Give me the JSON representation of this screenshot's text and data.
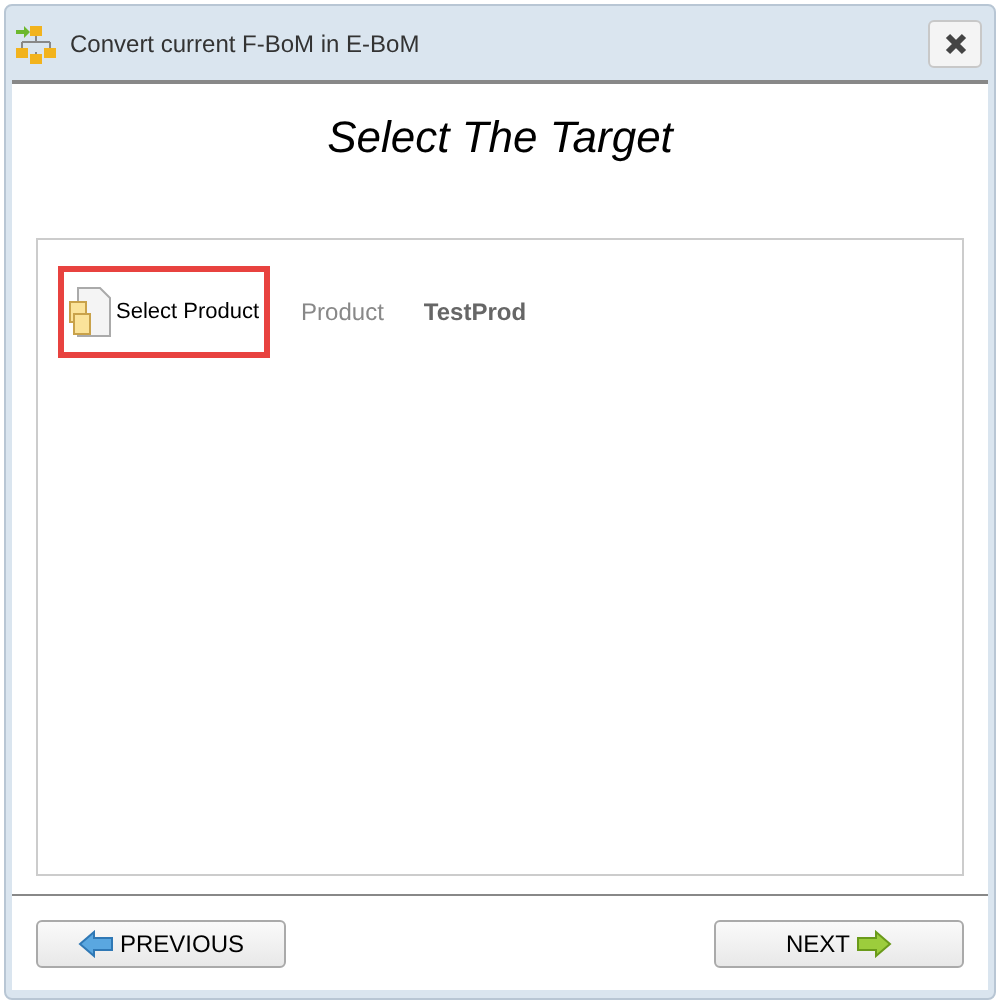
{
  "window": {
    "title": "Convert current F-BoM in E-BoM"
  },
  "heading": "Select The Target",
  "selector": {
    "label": "Select Product",
    "selected": true,
    "field_label": "Product",
    "value": "TestProd"
  },
  "buttons": [
    {
      "label": "PREVIOUS",
      "kind": "previous"
    },
    {
      "label": "NEXT",
      "kind": "next"
    }
  ]
}
